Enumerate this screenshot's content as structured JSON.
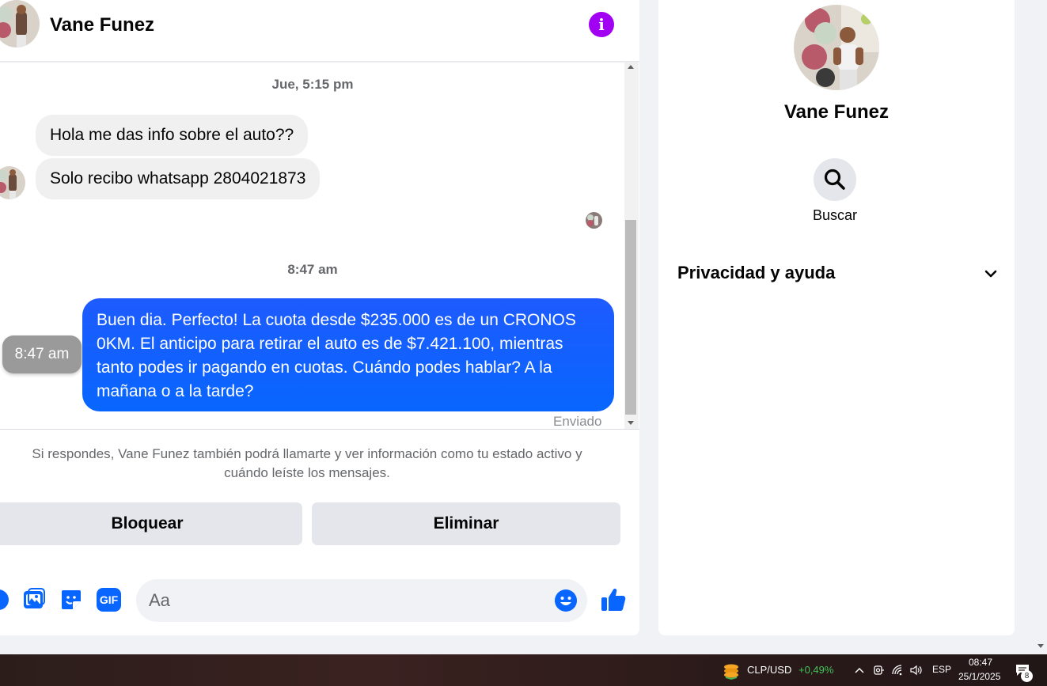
{
  "header": {
    "name": "Vane Funez",
    "info_icon": "i"
  },
  "messages": {
    "ts1": "Jue, 5:15 pm",
    "in1": "Hola me das info sobre el auto??",
    "in2": "Solo recibo whatsapp 2804021873",
    "ts2": "8:47 am",
    "hover_time": "8:47 am",
    "out_line1": "Buen dia. Perfecto! La cuota desde $235.000 es de un CRONOS",
    "out_line2": "0KM. El anticipo para retirar el auto es de $7.421.100, mientras",
    "out_line3": "tanto podes ir pagando en cuotas. Cuándo podes hablar? A la",
    "out_line4": "mañana o a la tarde?",
    "status": "Enviado"
  },
  "notice": {
    "line1": "Si respondes, Vane Funez también podrá llamarte y ver información como tu estado activo y",
    "line2": "cuándo leíste los mensajes."
  },
  "actions": {
    "block": "Bloquear",
    "delete": "Eliminar"
  },
  "composer": {
    "placeholder": "Aa",
    "gif_label": "GIF"
  },
  "right_panel": {
    "name": "Vane Funez",
    "search_label": "Buscar",
    "privacy_label": "Privacidad y ayuda"
  },
  "taskbar": {
    "ticker": "CLP/USD",
    "ticker_change": "+0,49%",
    "lang": "ESP",
    "time": "08:47",
    "date": "25/1/2025",
    "notif_count": "8"
  },
  "colors": {
    "accent_blue": "#0866ff",
    "info_purple": "#a100f2",
    "ticker_green": "#3fc35a"
  }
}
